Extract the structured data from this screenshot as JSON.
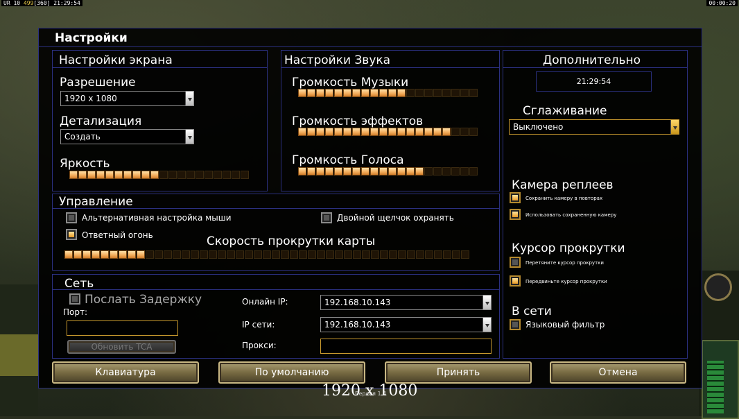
{
  "topbar": {
    "left_prefix": "UR 10",
    "left_value": "499",
    "left_bracket": "[360]",
    "left_time": "21:29:54",
    "right_time": "00:00:20"
  },
  "dialog": {
    "title": "Настройки"
  },
  "screen": {
    "title": "Настройки экрана",
    "resolution_label": "Разрешение",
    "resolution_value": "1920 x 1080",
    "detail_label": "Детализация",
    "detail_value": "Создать",
    "brightness_label": "Яркость",
    "brightness_level": 0.5
  },
  "sound": {
    "title": "Настройки Звука",
    "music_label": "Громкость Музыки",
    "music_level": 0.6,
    "effects_label": "Громкость эффектов",
    "effects_level": 0.85,
    "voice_label": "Громкость Голоса",
    "voice_level": 0.7
  },
  "extra": {
    "title": "Дополнительно",
    "clock": "21:29:54",
    "aa_label": "Сглаживание",
    "aa_value": "Выключено",
    "replay_cam_title": "Камера реплеев",
    "replay_opt1": "Сохранить камеру в повторах",
    "replay_opt2": "Использовать сохраненную камеру",
    "cursor_title": "Курсор прокрутки",
    "cursor_opt1": "Перетяните курсор прокрутки",
    "cursor_opt2": "Передвиньте курсор прокрутки",
    "online_title": "В сети",
    "lang_filter": "Языковый фильтр"
  },
  "control": {
    "title": "Управление",
    "alt_mouse": "Альтернативная настройка мыши",
    "double_click": "Двойной щелчок охранять",
    "return_fire": "Ответный огонь",
    "scroll_speed_label": "Скорость прокрутки карты",
    "scroll_level": 0.2
  },
  "network": {
    "title": "Сеть",
    "send_delay": "Послать Задержку",
    "port_label": "Порт:",
    "update_tca": "Обновить TCA",
    "online_ip_label": "Онлайн IP:",
    "online_ip_value": "192.168.10.143",
    "lan_ip_label": "IP сети:",
    "lan_ip_value": "192.168.10.143",
    "proxy_label": "Прокси:"
  },
  "buttons": {
    "keyboard": "Клавиатура",
    "defaults": "По умолчанию",
    "accept": "Принять",
    "cancel": "Отмена"
  },
  "caption": "1920 x 1080",
  "version": "Версия 1.4"
}
